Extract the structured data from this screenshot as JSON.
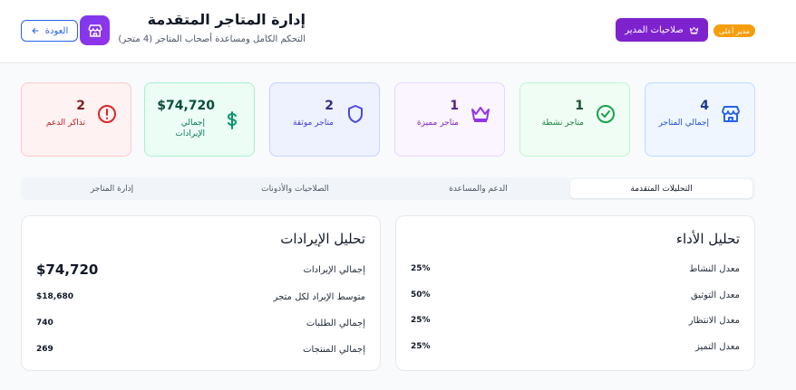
{
  "header": {
    "title": "إدارة المتاجر المتقدمة",
    "subtitle": "التحكم الكامل ومساعدة أصحاب المتاجر (4 متجر)",
    "back_label": "العودة",
    "admin_button_label": "صلاحيات المدير",
    "role_badge": "مدير أعلى",
    "icons": {
      "store": "store-icon",
      "back": "arrow-left-icon",
      "crown": "crown-icon"
    }
  },
  "stats": [
    {
      "value": "4",
      "label": "إجمالي المتاجر",
      "icon": "store-icon",
      "color": "#2563eb"
    },
    {
      "value": "1",
      "label": "متاجر نشطة",
      "icon": "check-circle-icon",
      "color": "#16a34a"
    },
    {
      "value": "1",
      "label": "متاجر مميزة",
      "icon": "crown-icon",
      "color": "#9333ea"
    },
    {
      "value": "2",
      "label": "متاجر موثقة",
      "icon": "shield-icon",
      "color": "#4f46e5"
    },
    {
      "value": "$74,720",
      "label": "إجمالي الإيرادات",
      "icon": "dollar-icon",
      "color": "#059669"
    },
    {
      "value": "2",
      "label": "تذاكر الدعم",
      "icon": "alert-circle-icon",
      "color": "#dc2626"
    }
  ],
  "tabs": [
    {
      "label": "التحليلات المتقدمة",
      "active": true
    },
    {
      "label": "الدعم والمساعدة",
      "active": false
    },
    {
      "label": "الصلاحيات والأذونات",
      "active": false
    },
    {
      "label": "إدارة المتاجر",
      "active": false
    }
  ],
  "performance": {
    "title": "تحليل الأداء",
    "rows": [
      {
        "label": "معدل النشاط",
        "value": "25%"
      },
      {
        "label": "معدل التوثيق",
        "value": "50%"
      },
      {
        "label": "معدل الانتظار",
        "value": "25%"
      },
      {
        "label": "معدل التميز",
        "value": "25%"
      }
    ]
  },
  "revenue": {
    "title": "تحليل الإيرادات",
    "rows": [
      {
        "label": "إجمالي الإيرادات",
        "value": "$74,720"
      },
      {
        "label": "متوسط الإيراد لكل متجر",
        "value": "$18,680"
      },
      {
        "label": "إجمالي الطلبات",
        "value": "740"
      },
      {
        "label": "إجمالي المنتجات",
        "value": "269"
      }
    ]
  }
}
